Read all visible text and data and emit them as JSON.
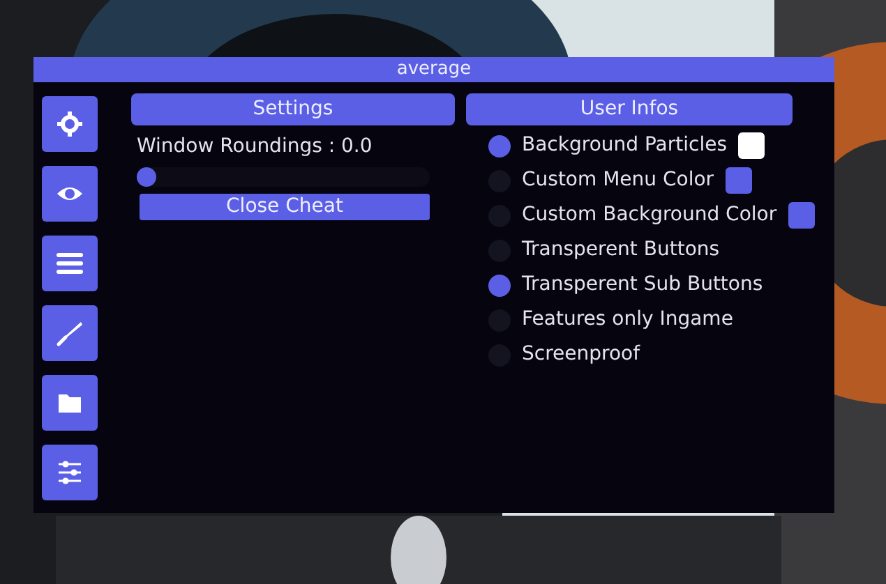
{
  "window": {
    "title": "average"
  },
  "settings": {
    "title": "Settings",
    "slider": {
      "label": "Window Roundings : 0.0",
      "level": 0
    },
    "button": "Close Cheat"
  },
  "user_infos": {
    "title": "User Infos",
    "options": [
      {
        "label": "Background Particles",
        "checked": true,
        "color": "#ffffff"
      },
      {
        "label": "Custom Menu Color",
        "checked": false,
        "color": "#5b5fe6"
      },
      {
        "label": "Custom Background Color",
        "checked": false,
        "color": "#5b5fe6"
      },
      {
        "label": "Transperent Buttons",
        "checked": false
      },
      {
        "label": "Transperent Sub Buttons",
        "checked": true
      },
      {
        "label": "Features only Ingame",
        "checked": false
      },
      {
        "label": "Screenproof",
        "checked": false
      }
    ]
  }
}
